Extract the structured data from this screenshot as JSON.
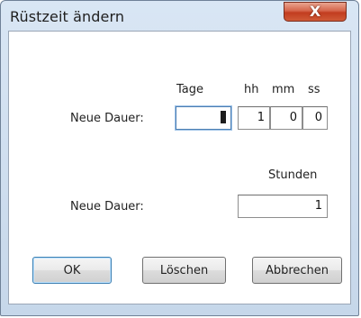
{
  "window": {
    "title": "Rüstzeit ändern",
    "close_glyph": "X"
  },
  "duration_dhms": {
    "label": "Neue Dauer:",
    "headers": {
      "days": "Tage",
      "hours": "hh",
      "minutes": "mm",
      "seconds": "ss"
    },
    "values": {
      "days": "",
      "hours": "1",
      "minutes": "0",
      "seconds": "0"
    }
  },
  "duration_hours": {
    "label": "Neue Dauer:",
    "header": "Stunden",
    "value": "1"
  },
  "buttons": {
    "ok": "OK",
    "clear": "Löschen",
    "cancel": "Abbrechen"
  },
  "colors": {
    "close_button": "#c94a2c",
    "default_button_border": "#3c7fb1",
    "focus_border": "#4d7fb3"
  }
}
